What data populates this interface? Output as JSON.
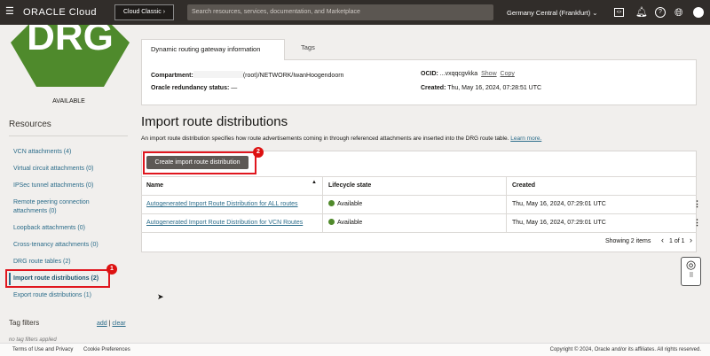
{
  "header": {
    "brand": "ORACLE Cloud",
    "classic_button": "Cloud Classic",
    "search_placeholder": "Search resources, services, documentation, and Marketplace",
    "region": "Germany Central (Frankfurt)",
    "icons": [
      "menu-icon",
      "code-editor-icon",
      "bell-icon",
      "help-icon",
      "globe-icon",
      "user-icon"
    ]
  },
  "resource": {
    "logo_text": "DRG",
    "logo_color": "#4f8a2c",
    "state": "AVAILABLE"
  },
  "sidebar": {
    "title": "Resources",
    "items": [
      {
        "label": "VCN attachments (4)"
      },
      {
        "label": "Virtual circuit attachments (0)"
      },
      {
        "label": "IPSec tunnel attachments (0)"
      },
      {
        "label": "Remote peering connection attachments (0)"
      },
      {
        "label": "Loopback attachments (0)"
      },
      {
        "label": "Cross-tenancy attachments (0)"
      },
      {
        "label": "DRG route tables (2)"
      },
      {
        "label": "Import route distributions (2)",
        "selected": true
      },
      {
        "label": "Export route distributions (1)"
      }
    ],
    "tag_filters": {
      "title": "Tag filters",
      "add": "add",
      "sep": "|",
      "clear": "clear",
      "empty": "no tag filters applied"
    },
    "annotation": "1"
  },
  "info": {
    "tabs": [
      "Dynamic routing gateway information",
      "Tags"
    ],
    "compartment_label": "Compartment:",
    "compartment_value": "(root)/NETWORK/IwanHoogendoorn",
    "redundancy_label": "Oracle redundancy status:",
    "redundancy_value": "—",
    "ocid_label": "OCID:",
    "ocid_value": "...vxqqcgvkka",
    "show": "Show",
    "copy": "Copy",
    "created_label": "Created:",
    "created_value": "Thu, May 16, 2024, 07:28:51 UTC"
  },
  "main": {
    "title": "Import route distributions",
    "description": "An import route distribution specifies how route advertisements coming in through referenced attachments are inserted into the DRG route table.",
    "learn_more": "Learn more.",
    "create_button": "Create import route distribution",
    "annotation": "2",
    "columns": [
      "Name",
      "Lifecycle state",
      "Created"
    ],
    "rows": [
      {
        "name": "Autogenerated Import Route Distribution for ALL routes",
        "state": "Available",
        "created": "Thu, May 16, 2024, 07:29:01 UTC"
      },
      {
        "name": "Autogenerated Import Route Distribution for VCN Routes",
        "state": "Available",
        "created": "Thu, May 16, 2024, 07:29:01 UTC"
      }
    ],
    "showing": "Showing 2 items",
    "pagination": "1 of 1",
    "status_color": "#508a2b"
  },
  "footer": {
    "terms": "Terms of Use and Privacy",
    "cookies": "Cookie Preferences",
    "copyright": "Copyright © 2024, Oracle and/or its affiliates. All rights reserved."
  }
}
